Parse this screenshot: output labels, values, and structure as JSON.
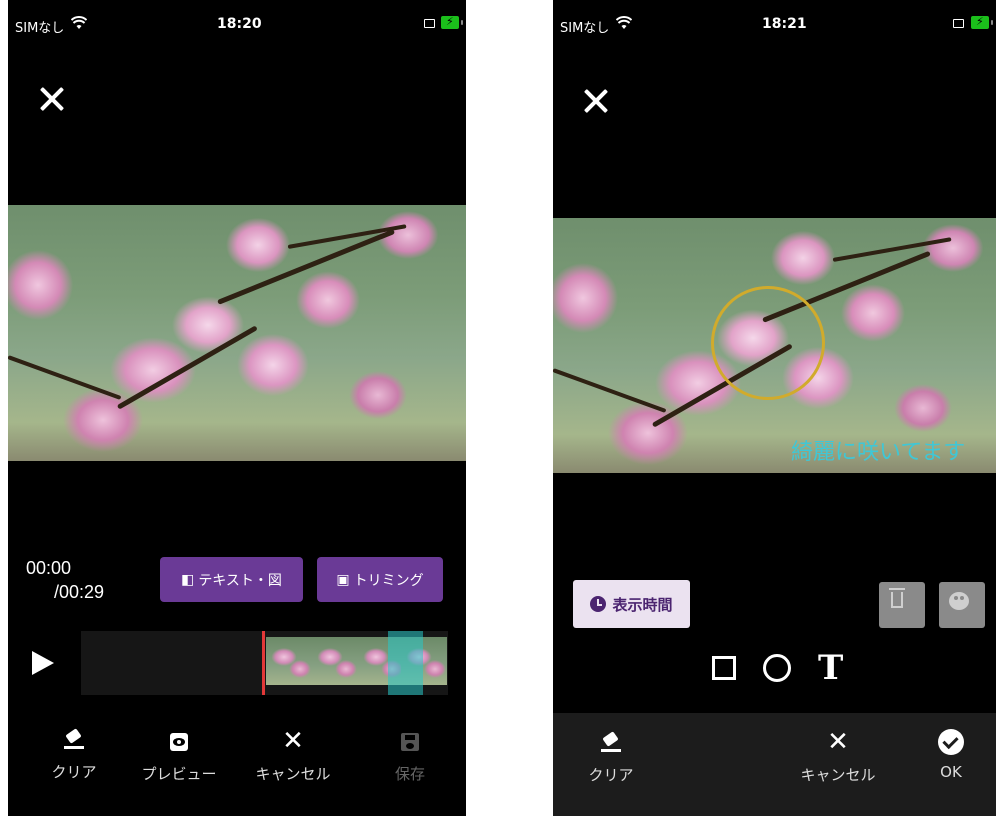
{
  "left": {
    "status": {
      "carrier": "SIMなし",
      "time": "18:20"
    },
    "current_time": "00:00",
    "total_time": "/00:29",
    "text_shape_button": "テキスト・図",
    "trim_button": "トリミング",
    "bottom": {
      "clear": "クリア",
      "preview": "プレビュー",
      "cancel": "キャンセル",
      "save": "保存"
    }
  },
  "right": {
    "status": {
      "carrier": "SIMなし",
      "time": "18:21"
    },
    "overlay_text": "綺麗に咲いてます",
    "display_time_button": "表示時間",
    "tools": [
      "rectangle",
      "circle",
      "text"
    ],
    "text_tool_glyph": "T",
    "bottom": {
      "clear": "クリア",
      "cancel": "キャンセル",
      "ok": "OK"
    }
  },
  "colors": {
    "accent_purple": "#6a3a96",
    "circle_annotation": "#d1ab2c",
    "overlay_text": "#3fc7d6",
    "playhead": "#e23838",
    "selection": "#28c8c8"
  },
  "icons": [
    "close-icon",
    "wifi-icon",
    "airplay-icon",
    "battery-icon",
    "play-icon",
    "eraser-icon",
    "eye-icon",
    "save-icon",
    "clock-icon",
    "trash-icon",
    "palette-icon",
    "check-icon"
  ]
}
